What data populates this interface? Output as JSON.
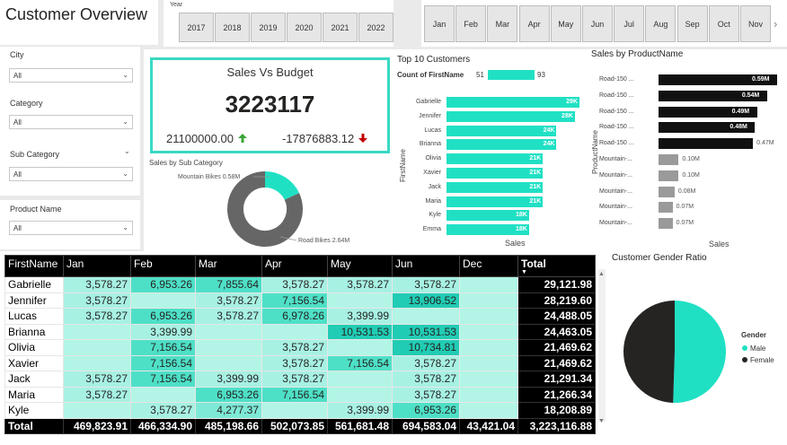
{
  "header": {
    "title": "Customer Overview"
  },
  "year_slicer": {
    "label": "Year",
    "items": [
      "2017",
      "2018",
      "2019",
      "2020",
      "2021",
      "2022"
    ]
  },
  "month_slicer": {
    "items": [
      "Jan",
      "Feb",
      "Mar",
      "Apr",
      "May",
      "Jun",
      "Jul",
      "Aug",
      "Sep",
      "Oct",
      "Nov"
    ],
    "next_icon": "chevron-right-icon"
  },
  "filters": [
    {
      "label": "City",
      "value": "All"
    },
    {
      "label": "Category",
      "value": "All"
    },
    {
      "label": "Sub Category",
      "value": "All"
    },
    {
      "label": "Product Name",
      "value": "All"
    }
  ],
  "kpi": {
    "title": "Sales Vs Budget",
    "value": "3223117",
    "budget": "21100000.00",
    "variance": "-17876883.12",
    "colors": {
      "up": "#3aa635",
      "down": "#c00000",
      "border": "#39d9c2"
    }
  },
  "donut": {
    "title": "Sales by Sub Category",
    "slices": [
      {
        "label": "Mountain Bikes 0.58M",
        "value": 0.58,
        "color": "#20e0c4"
      },
      {
        "label": "Road Bikes 2.64M",
        "value": 2.64,
        "color": "#666666"
      }
    ]
  },
  "top_customers": {
    "title": "Top 10 Customers",
    "slider_label": "Count of FirstName",
    "slider_min": "51",
    "slider_max": "93",
    "xlabel": "Sales",
    "ylabel": "FirstName",
    "color": "#20e0c4",
    "rows": [
      {
        "name": "Gabrielle",
        "value": 29,
        "label": "29K"
      },
      {
        "name": "Jennifer",
        "value": 28,
        "label": "28K"
      },
      {
        "name": "Lucas",
        "value": 24,
        "label": "24K"
      },
      {
        "name": "Brianna",
        "value": 24,
        "label": "24K"
      },
      {
        "name": "Olivia",
        "value": 21,
        "label": "21K"
      },
      {
        "name": "Xavier",
        "value": 21,
        "label": "21K"
      },
      {
        "name": "Jack",
        "value": 21,
        "label": "21K"
      },
      {
        "name": "Maria",
        "value": 21,
        "label": "21K"
      },
      {
        "name": "Kyle",
        "value": 18,
        "label": "18K"
      },
      {
        "name": "Emma",
        "value": 18,
        "label": "18K"
      }
    ]
  },
  "product_sales": {
    "title": "Sales by ProductName",
    "xlabel": "Sales",
    "ylabel": "ProductName",
    "rows": [
      {
        "name": "Road-150 ...",
        "value": 0.59,
        "label": "0.59M",
        "color": "#111111"
      },
      {
        "name": "Road-150 ...",
        "value": 0.54,
        "label": "0.54M",
        "color": "#111111"
      },
      {
        "name": "Road-150 ...",
        "value": 0.49,
        "label": "0.49M",
        "color": "#111111"
      },
      {
        "name": "Road-150 ...",
        "value": 0.48,
        "label": "0.48M",
        "color": "#111111"
      },
      {
        "name": "Road-150 ...",
        "value": 0.47,
        "label": "0.47M",
        "color": "#111111"
      },
      {
        "name": "Mountain-...",
        "value": 0.1,
        "label": "0.10M",
        "color": "#9a9a9a"
      },
      {
        "name": "Mountain-...",
        "value": 0.1,
        "label": "0.10M",
        "color": "#9a9a9a"
      },
      {
        "name": "Mountain-...",
        "value": 0.08,
        "label": "0.08M",
        "color": "#9a9a9a"
      },
      {
        "name": "Mountain-...",
        "value": 0.07,
        "label": "0.07M",
        "color": "#9a9a9a"
      },
      {
        "name": "Mountain-...",
        "value": 0.07,
        "label": "0.07M",
        "color": "#9a9a9a"
      }
    ]
  },
  "gender": {
    "title": "Customer Gender Ratio",
    "legend_title": "Gender",
    "slices": [
      {
        "label": "Male",
        "value": 50.5,
        "color": "#20e0c4"
      },
      {
        "label": "Female",
        "value": 49.5,
        "color": "#252423"
      }
    ]
  },
  "matrix": {
    "columns": [
      "FirstName",
      "Jan",
      "Feb",
      "Mar",
      "Apr",
      "May",
      "Jun",
      "Dec",
      "Total"
    ],
    "rows": [
      {
        "name": "Gabrielle",
        "cells": [
          "3,578.27",
          "6,953.26",
          "7,855.64",
          "3,578.27",
          "3,578.27",
          "3,578.27",
          ""
        ],
        "total": "29,121.98"
      },
      {
        "name": "Jennifer",
        "cells": [
          "3,578.27",
          "",
          "3,578.27",
          "7,156.54",
          "",
          "13,906.52",
          ""
        ],
        "total": "28,219.60"
      },
      {
        "name": "Lucas",
        "cells": [
          "3,578.27",
          "6,953.26",
          "3,578.27",
          "6,978.26",
          "3,399.99",
          "",
          ""
        ],
        "total": "24,488.05"
      },
      {
        "name": "Brianna",
        "cells": [
          "",
          "3,399.99",
          "",
          "",
          "10,531.53",
          "10,531.53",
          ""
        ],
        "total": "24,463.05"
      },
      {
        "name": "Olivia",
        "cells": [
          "",
          "7,156.54",
          "",
          "3,578.27",
          "",
          "10,734.81",
          ""
        ],
        "total": "21,469.62"
      },
      {
        "name": "Xavier",
        "cells": [
          "",
          "7,156.54",
          "",
          "3,578.27",
          "7,156.54",
          "3,578.27",
          ""
        ],
        "total": "21,469.62"
      },
      {
        "name": "Jack",
        "cells": [
          "3,578.27",
          "7,156.54",
          "3,399.99",
          "3,578.27",
          "",
          "3,578.27",
          ""
        ],
        "total": "21,291.34"
      },
      {
        "name": "Maria",
        "cells": [
          "3,578.27",
          "",
          "6,953.26",
          "7,156.54",
          "",
          "3,578.27",
          ""
        ],
        "total": "21,266.34"
      },
      {
        "name": "Kyle",
        "cells": [
          "",
          "3,578.27",
          "4,277.37",
          "",
          "3,399.99",
          "6,953.26",
          ""
        ],
        "total": "18,208.89"
      }
    ],
    "total_row": {
      "name": "Total",
      "cells": [
        "469,823.91",
        "466,334.90",
        "485,198.66",
        "502,073.85",
        "561,681.48",
        "694,583.04",
        "43,421.04"
      ],
      "total": "3,223,116.88"
    },
    "sort_icon": "sort-desc-icon"
  }
}
